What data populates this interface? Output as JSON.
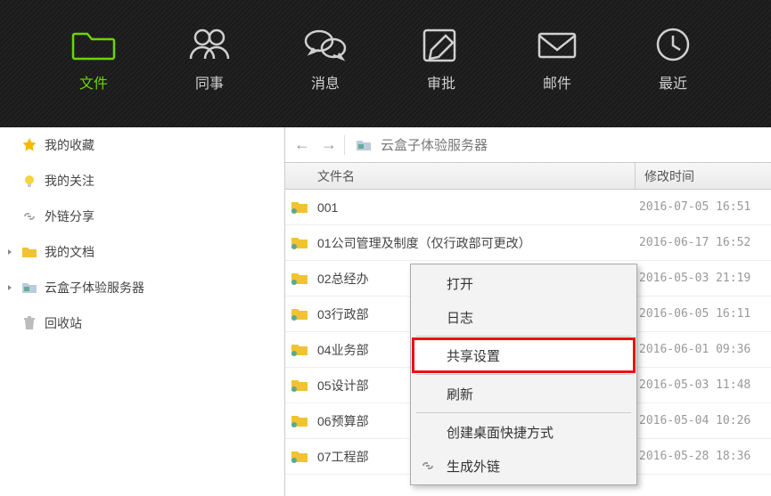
{
  "topnav": {
    "tabs": [
      {
        "name": "tab-files",
        "label": "文件"
      },
      {
        "name": "tab-colleagues",
        "label": "同事"
      },
      {
        "name": "tab-messages",
        "label": "消息"
      },
      {
        "name": "tab-approval",
        "label": "审批"
      },
      {
        "name": "tab-mail",
        "label": "邮件"
      },
      {
        "name": "tab-recent",
        "label": "最近"
      }
    ]
  },
  "sidebar": {
    "items": [
      {
        "name": "sidebar-favorites",
        "label": "我的收藏"
      },
      {
        "name": "sidebar-follow",
        "label": "我的关注"
      },
      {
        "name": "sidebar-share",
        "label": "外链分享"
      },
      {
        "name": "sidebar-mydocs",
        "label": "我的文档",
        "tree": true
      },
      {
        "name": "sidebar-server",
        "label": "云盒子体验服务器",
        "tree": true,
        "selected": true
      },
      {
        "name": "sidebar-trash",
        "label": "回收站"
      }
    ]
  },
  "breadcrumb": {
    "label": "云盒子体验服务器"
  },
  "table": {
    "headers": {
      "name": "文件名",
      "time": "修改时间"
    },
    "rows": [
      {
        "label": "001",
        "time": "2016-07-05 16:51"
      },
      {
        "label": "01公司管理及制度（仅行政部可更改）",
        "time": "2016-06-17 16:52"
      },
      {
        "label": "02总经办",
        "time": "2016-05-03 21:19",
        "selected": true
      },
      {
        "label": "03行政部",
        "time": "2016-06-05 16:11"
      },
      {
        "label": "04业务部",
        "time": "2016-06-01 09:36"
      },
      {
        "label": "05设计部",
        "time": "2016-05-03 11:48"
      },
      {
        "label": "06预算部",
        "time": "2016-05-04 10:26"
      },
      {
        "label": "07工程部",
        "time": "2016-05-28 18:36"
      }
    ]
  },
  "context_menu": {
    "items": [
      {
        "name": "ctx-open",
        "label": "打开"
      },
      {
        "name": "ctx-log",
        "label": "日志"
      },
      {
        "name": "ctx-share-settings",
        "label": "共享设置",
        "highlight": true
      },
      {
        "name": "ctx-refresh",
        "label": "刷新"
      },
      {
        "name": "ctx-desktop",
        "label": "创建桌面快捷方式"
      },
      {
        "name": "ctx-genlink",
        "label": "生成外链",
        "link_icon": true
      }
    ],
    "separators_after": [
      1,
      2,
      3
    ]
  }
}
